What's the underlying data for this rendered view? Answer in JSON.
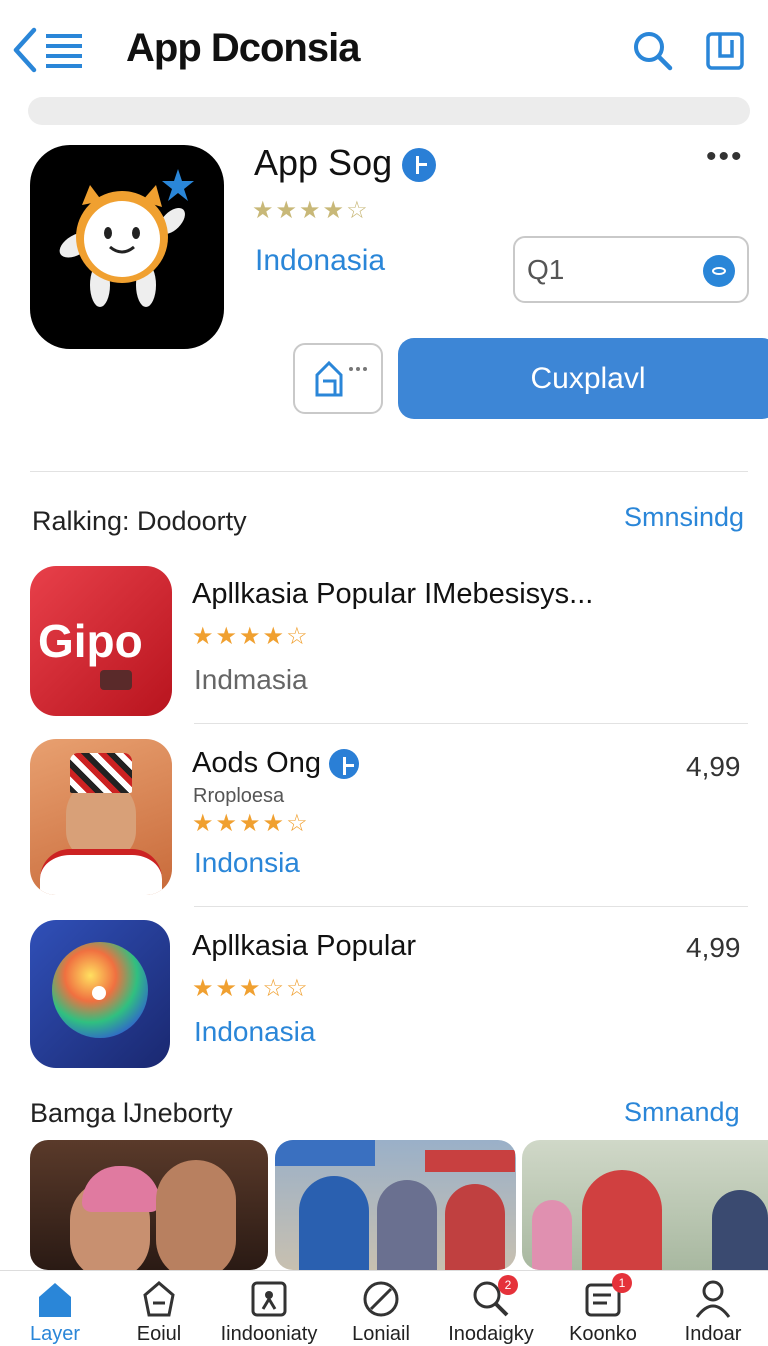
{
  "header": {
    "title": "App Dconsia"
  },
  "app": {
    "name": "App Sog",
    "rating_stars": "★★★★☆",
    "region": "Indonasia",
    "field_value": "Q1",
    "primary_button": "Cuxplavl"
  },
  "section1": {
    "title": "Ralking: Dodoorty",
    "link": "Smnsindg",
    "items": [
      {
        "name": "Apllkasia Popular  IMebesisys...",
        "icon_text": "Gipo",
        "stars": "★★★★☆",
        "region": "Indmasia",
        "price": "",
        "sub": ""
      },
      {
        "name": "Aods Ong",
        "icon_text": "",
        "stars": "★★★★☆",
        "region": "Indonsia",
        "price": "4,99",
        "sub": "Rroploesa"
      },
      {
        "name": "Apllkasia Popular",
        "icon_text": "",
        "stars": "★★★☆☆",
        "region": "Indonasia",
        "price": "4,99",
        "sub": ""
      }
    ]
  },
  "section2": {
    "title": "Bamga lJneborty",
    "link": "Smnandg"
  },
  "tabbar": {
    "tabs": [
      {
        "label": "Layer",
        "badge": ""
      },
      {
        "label": "Eoiul",
        "badge": ""
      },
      {
        "label": "Iindooniaty",
        "badge": ""
      },
      {
        "label": "Loniail",
        "badge": ""
      },
      {
        "label": "Inodaigky",
        "badge": "2"
      },
      {
        "label": "Koonko",
        "badge": "1"
      },
      {
        "label": "Indoar",
        "badge": ""
      }
    ]
  },
  "colors": {
    "accent": "#2a86d8",
    "primary_button": "#3d86d6",
    "star": "#f0a030"
  }
}
